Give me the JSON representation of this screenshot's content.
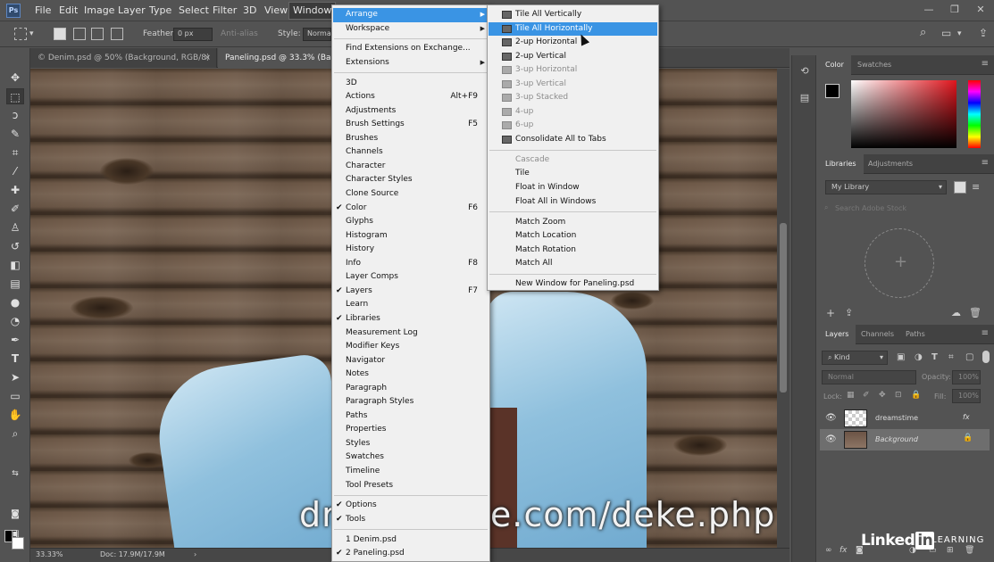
{
  "app": {
    "logo": "Ps"
  },
  "menubar": {
    "items": [
      "File",
      "Edit",
      "Image",
      "Layer",
      "Type",
      "Select",
      "Filter",
      "3D",
      "View",
      "Window"
    ],
    "active": "Window"
  },
  "options": {
    "feather_label": "Feather:",
    "feather_value": "0 px",
    "antialias_label": "Anti-alias",
    "style_label": "Style:",
    "style_value": "Normal"
  },
  "tabs": [
    {
      "label": "© Denim.psd @ 50% (Background, RGB/8)",
      "close": "×"
    },
    {
      "label": "Paneling.psd @ 33.3% (Bac",
      "close": "×"
    }
  ],
  "status": {
    "zoom": "33.33%",
    "doc": "Doc: 17.9M/17.9M",
    "arrow": "›"
  },
  "watermark": "dreamstime.com/deke.php",
  "window_menu": {
    "groups": [
      [
        {
          "label": "Arrange",
          "arrow": true,
          "hl": true
        },
        {
          "label": "Workspace",
          "arrow": true
        }
      ],
      [
        {
          "label": "Find Extensions on Exchange..."
        },
        {
          "label": "Extensions",
          "arrow": true
        }
      ],
      [
        {
          "label": "3D"
        },
        {
          "label": "Actions",
          "shortcut": "Alt+F9"
        },
        {
          "label": "Adjustments"
        },
        {
          "label": "Brush Settings",
          "shortcut": "F5"
        },
        {
          "label": "Brushes"
        },
        {
          "label": "Channels"
        },
        {
          "label": "Character"
        },
        {
          "label": "Character Styles"
        },
        {
          "label": "Clone Source"
        },
        {
          "label": "Color",
          "shortcut": "F6",
          "checked": true
        },
        {
          "label": "Glyphs"
        },
        {
          "label": "Histogram"
        },
        {
          "label": "History"
        },
        {
          "label": "Info",
          "shortcut": "F8"
        },
        {
          "label": "Layer Comps"
        },
        {
          "label": "Layers",
          "shortcut": "F7",
          "checked": true
        },
        {
          "label": "Learn"
        },
        {
          "label": "Libraries",
          "checked": true
        },
        {
          "label": "Measurement Log"
        },
        {
          "label": "Modifier Keys"
        },
        {
          "label": "Navigator"
        },
        {
          "label": "Notes"
        },
        {
          "label": "Paragraph"
        },
        {
          "label": "Paragraph Styles"
        },
        {
          "label": "Paths"
        },
        {
          "label": "Properties"
        },
        {
          "label": "Styles"
        },
        {
          "label": "Swatches"
        },
        {
          "label": "Timeline"
        },
        {
          "label": "Tool Presets"
        }
      ],
      [
        {
          "label": "Options",
          "checked": true
        },
        {
          "label": "Tools",
          "checked": true
        }
      ],
      [
        {
          "label": "1 Denim.psd"
        },
        {
          "label": "2 Paneling.psd",
          "checked": true
        }
      ]
    ]
  },
  "arrange_menu": {
    "groups": [
      [
        {
          "label": "Tile All Vertically",
          "icon": "tile-vertical-icon"
        },
        {
          "label": "Tile All Horizontally",
          "icon": "tile-horizontal-icon",
          "hl": true
        },
        {
          "label": "2-up Horizontal",
          "icon": "two-up-horizontal-icon"
        },
        {
          "label": "2-up Vertical",
          "icon": "two-up-vertical-icon"
        },
        {
          "label": "3-up Horizontal",
          "icon": "three-up-horizontal-icon",
          "disabled": true
        },
        {
          "label": "3-up Vertical",
          "icon": "three-up-vertical-icon",
          "disabled": true
        },
        {
          "label": "3-up Stacked",
          "icon": "three-up-stacked-icon",
          "disabled": true
        },
        {
          "label": "4-up",
          "icon": "four-up-icon",
          "disabled": true
        },
        {
          "label": "6-up",
          "icon": "six-up-icon",
          "disabled": true
        },
        {
          "label": "Consolidate All to Tabs",
          "icon": "consolidate-tabs-icon"
        }
      ],
      [
        {
          "label": "Cascade",
          "disabled": true
        },
        {
          "label": "Tile"
        },
        {
          "label": "Float in Window"
        },
        {
          "label": "Float All in Windows"
        }
      ],
      [
        {
          "label": "Match Zoom"
        },
        {
          "label": "Match Location"
        },
        {
          "label": "Match Rotation"
        },
        {
          "label": "Match All"
        }
      ],
      [
        {
          "label": "New Window for Paneling.psd"
        }
      ]
    ]
  },
  "panels": {
    "color_tabs": [
      "Color",
      "Swatches"
    ],
    "libraries_tabs": [
      "Libraries",
      "Adjustments"
    ],
    "library_select": "My Library",
    "search_placeholder": "Search Adobe Stock",
    "layers_tabs": [
      "Layers",
      "Channels",
      "Paths"
    ],
    "kind_filter": "Kind",
    "blend_mode": "Normal",
    "opacity_label": "Opacity:",
    "opacity_value": "100%",
    "lock_label": "Lock:",
    "fill_label": "Fill:",
    "fill_value": "100%",
    "layers": [
      {
        "name": "dreamstime",
        "fx": "fx"
      },
      {
        "name": "Background",
        "locked": true
      }
    ]
  },
  "branding": {
    "linkedin": "Linked",
    "in": "in",
    "learning": "LEARNING"
  },
  "colors": {
    "menu_highlight": "#3a94e4",
    "menu_bg": "#f0f0f0",
    "ui_bg": "#535353"
  }
}
